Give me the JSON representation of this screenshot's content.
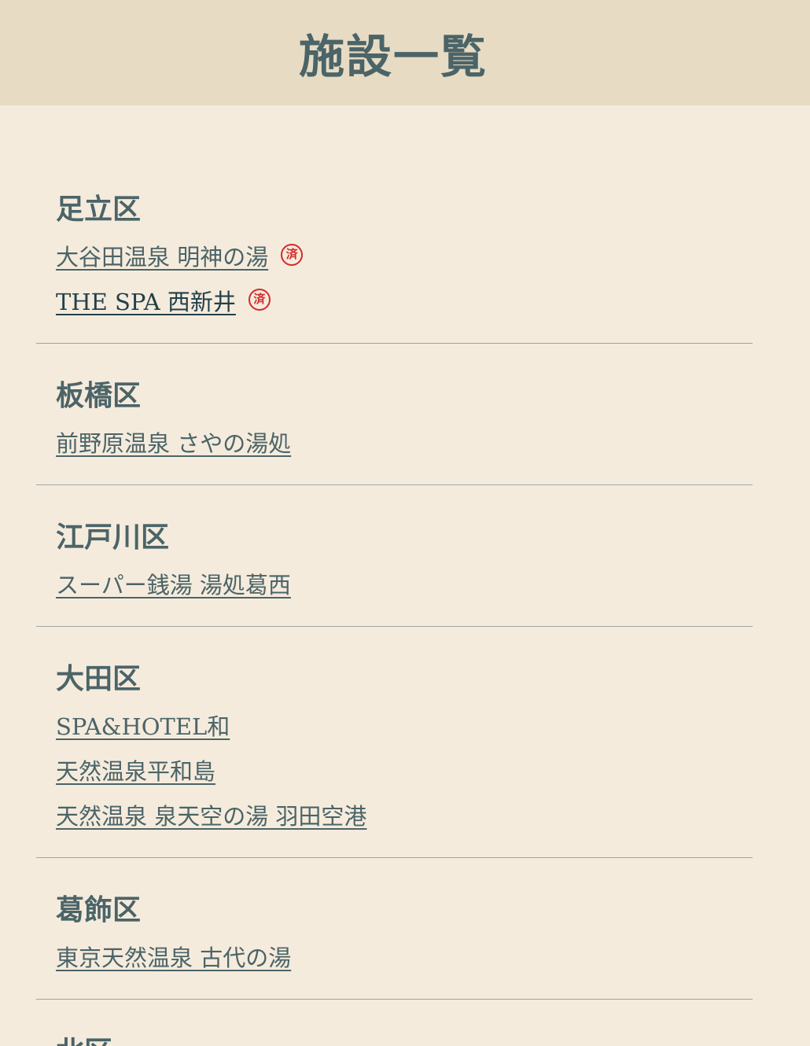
{
  "header": {
    "title": "施設一覧"
  },
  "colors": {
    "background": "#f5ebdc",
    "header_bg": "#e7dbc4",
    "text": "#4b6468",
    "stamp": "#d42a2a",
    "divider": "#9ba6a3"
  },
  "wards": [
    {
      "name": "足立区",
      "facilities": [
        {
          "name": "大谷田温泉 明神の湯",
          "visited": true,
          "stamp": "済"
        },
        {
          "name": "THE SPA 西新井",
          "visited": true,
          "stamp": "済"
        }
      ]
    },
    {
      "name": "板橋区",
      "facilities": [
        {
          "name": "前野原温泉 さやの湯処",
          "visited": false
        }
      ]
    },
    {
      "name": "江戸川区",
      "facilities": [
        {
          "name": "スーパー銭湯 湯処葛西",
          "visited": false
        }
      ]
    },
    {
      "name": "大田区",
      "facilities": [
        {
          "name": "SPA&HOTEL和",
          "visited": false
        },
        {
          "name": "天然温泉平和島",
          "visited": false
        },
        {
          "name": "天然温泉 泉天空の湯 羽田空港",
          "visited": false
        }
      ]
    },
    {
      "name": "葛飾区",
      "facilities": [
        {
          "name": "東京天然温泉 古代の湯",
          "visited": false
        }
      ]
    },
    {
      "name": "北区",
      "facilities": []
    }
  ]
}
